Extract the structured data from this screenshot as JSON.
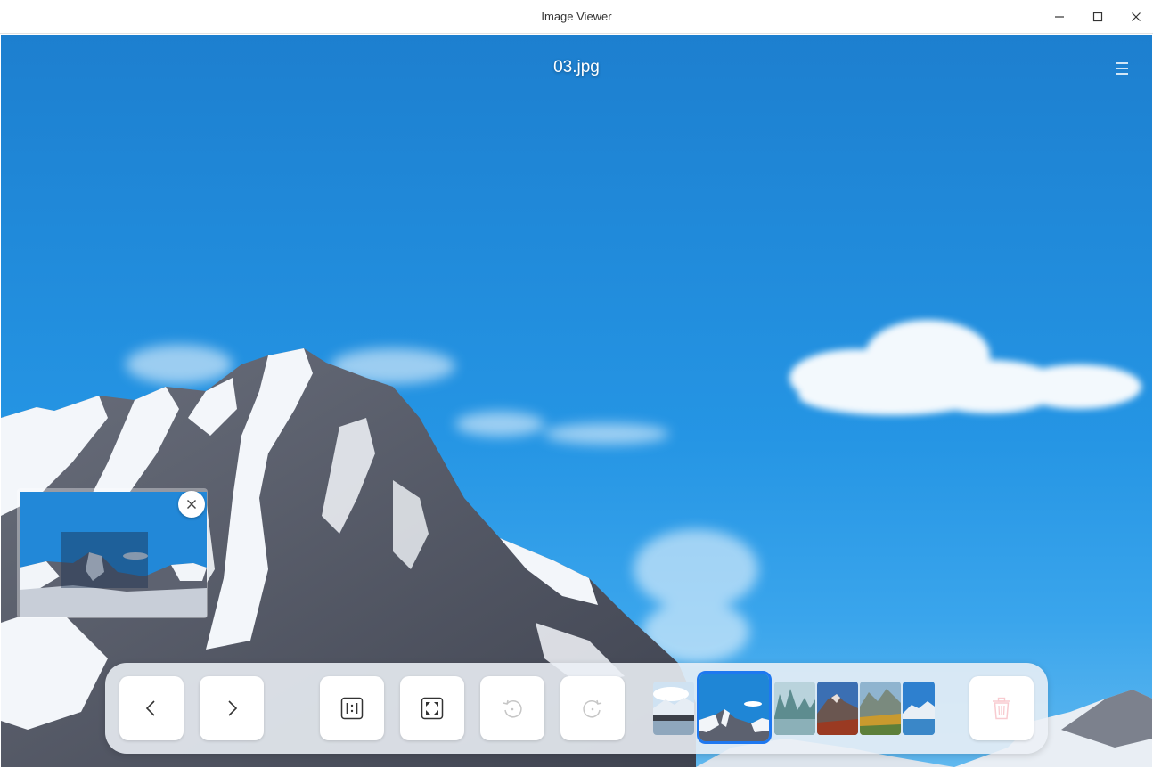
{
  "window": {
    "title": "Image Viewer",
    "controls": [
      "minimize-icon",
      "maximize-icon",
      "close-icon"
    ]
  },
  "viewer": {
    "file_name": "03.jpg",
    "menu_icon": "hamburger-menu-icon"
  },
  "navigation_preview": {
    "close_icon": "close-icon"
  },
  "toolbar": {
    "buttons": [
      {
        "name": "previous-button",
        "icon": "chevron-left-icon",
        "enabled": true
      },
      {
        "name": "next-button",
        "icon": "chevron-right-icon",
        "enabled": true
      },
      {
        "name": "original-size-button",
        "icon": "one-to-one-icon",
        "enabled": true
      },
      {
        "name": "fit-window-button",
        "icon": "fit-to-window-icon",
        "enabled": true
      },
      {
        "name": "rotate-left-button",
        "icon": "rotate-counterclockwise-icon",
        "enabled": false
      },
      {
        "name": "rotate-right-button",
        "icon": "rotate-clockwise-icon",
        "enabled": false
      },
      {
        "name": "delete-button",
        "icon": "trash-icon",
        "enabled": false
      }
    ],
    "thumbnails": [
      {
        "name": "thumbnail-1",
        "current": false
      },
      {
        "name": "thumbnail-2",
        "current": true
      },
      {
        "name": "thumbnail-3",
        "current": false
      },
      {
        "name": "thumbnail-4",
        "current": false
      },
      {
        "name": "thumbnail-5",
        "current": false
      },
      {
        "name": "thumbnail-6",
        "current": false
      }
    ]
  },
  "colors": {
    "sky": "#2089d9",
    "accent": "#1e78f0",
    "delete_icon": "#f3a1aa"
  }
}
